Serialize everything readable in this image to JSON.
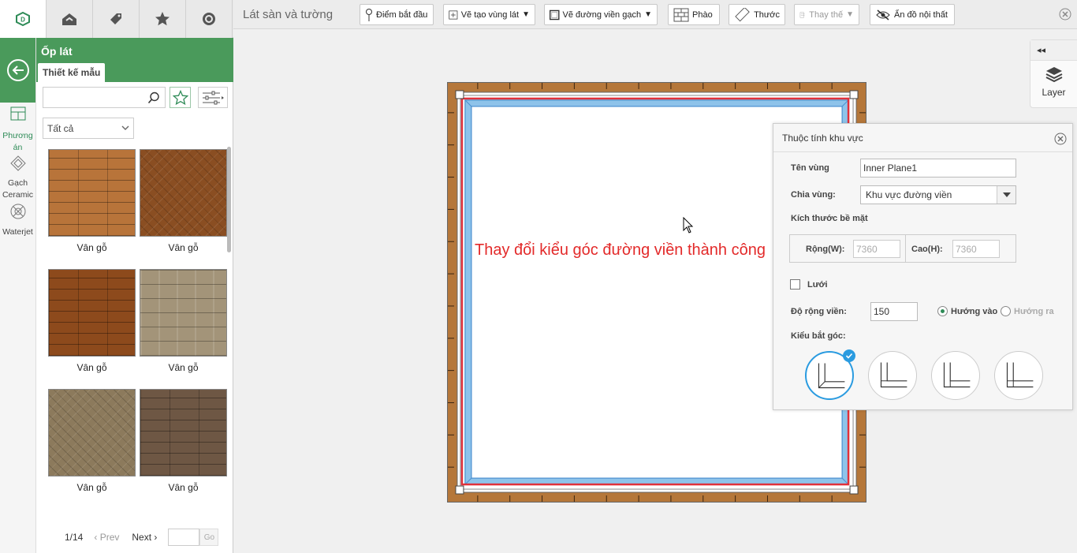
{
  "topnav": {
    "tabs": [
      {
        "name": "logo-icon"
      },
      {
        "name": "house-icon"
      },
      {
        "name": "tag-icon"
      },
      {
        "name": "star-icon"
      },
      {
        "name": "compass-icon"
      }
    ]
  },
  "toolbar": {
    "title": "Lát sàn và tường",
    "start_point": "Điểm bắt đầu",
    "create_area": "Vẽ tạo vùng lát",
    "draw_border": "Vẽ đường viền gạch",
    "molding": "Phào",
    "ruler": "Thước",
    "replace": "Thay thế",
    "hide_furniture": "Ẩn đồ nội thất"
  },
  "sidebar": {
    "items": [
      {
        "label": "Phương án",
        "icon": "layout-icon"
      },
      {
        "label": "Gạch Ceramic",
        "icon": "tile-icon"
      },
      {
        "label": "Waterjet",
        "icon": "waterjet-icon"
      }
    ]
  },
  "panel": {
    "title": "Ốp lát",
    "subtab": "Thiết kế mẫu",
    "search": {
      "placeholder": ""
    },
    "category": "Tất cả",
    "tiles": [
      {
        "label": "Vân gỗ",
        "color": "#b8743a",
        "pattern": "brick"
      },
      {
        "label": "Vân gỗ",
        "color": "#8a4e22",
        "pattern": "herring"
      },
      {
        "label": "Vân gỗ",
        "color": "#8d4a1c",
        "pattern": "brick"
      },
      {
        "label": "Vân gỗ",
        "color": "#a39479",
        "pattern": "plank"
      },
      {
        "label": "Vân gỗ",
        "color": "#8c7a5c",
        "pattern": "herring"
      },
      {
        "label": "Vân gỗ",
        "color": "#6e5744",
        "pattern": "brick"
      }
    ],
    "pager": {
      "page": "1/14",
      "prev": "Prev",
      "next": "Next",
      "go": "Go"
    }
  },
  "layer": {
    "label": "Layer"
  },
  "toast": "Thay đổi kiểu góc đường viền thành công",
  "props": {
    "title": "Thuộc tính khu vực",
    "name_label": "Tên vùng",
    "name_value": "Inner Plane1",
    "split_label": "Chia vùng:",
    "split_value": "Khu vực đường viền",
    "surface_label": "Kích thước bề mặt",
    "width_label": "Rộng(W):",
    "width_value": "7360",
    "height_label": "Cao(H):",
    "height_value": "7360",
    "grid_label": "Lưới",
    "border_width_label": "Độ rộng viền:",
    "border_width_value": "150",
    "inward": "Hướng vào",
    "outward": "Hướng ra",
    "corner_label": "Kiểu bắt góc:",
    "selected_corner": 1
  }
}
